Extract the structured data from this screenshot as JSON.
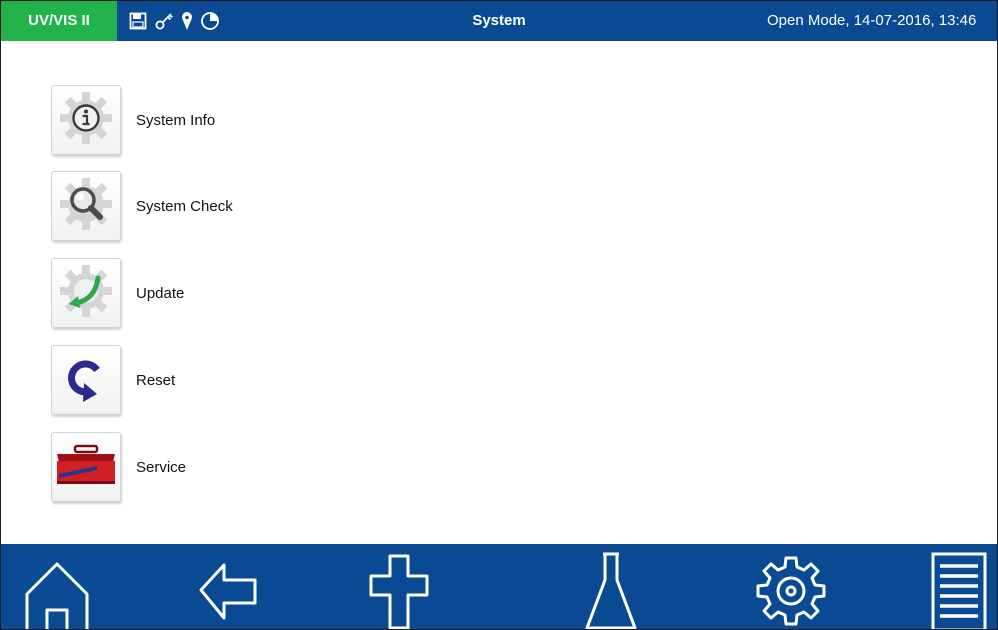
{
  "header": {
    "device_label": "UV/VIS II",
    "title": "System",
    "status": "Open Mode, 14-07-2016, 13:46",
    "colors": {
      "bar": "#0a4a93",
      "device": "#22b24c"
    },
    "status_icons": [
      "save-icon",
      "key-icon",
      "location-pin-icon",
      "pie-clock-icon"
    ]
  },
  "menu": {
    "items": [
      {
        "label": "System Info",
        "icon": "info-gear-icon"
      },
      {
        "label": "System Check",
        "icon": "magnifier-gear-icon"
      },
      {
        "label": "Update",
        "icon": "update-arrow-gear-icon"
      },
      {
        "label": "Reset",
        "icon": "reset-arrow-icon"
      },
      {
        "label": "Service",
        "icon": "toolbox-icon"
      }
    ]
  },
  "nav": {
    "buttons": [
      "home-icon",
      "back-arrow-icon",
      "plus-icon",
      "flask-icon",
      "settings-gear-icon",
      "list-icon"
    ]
  }
}
